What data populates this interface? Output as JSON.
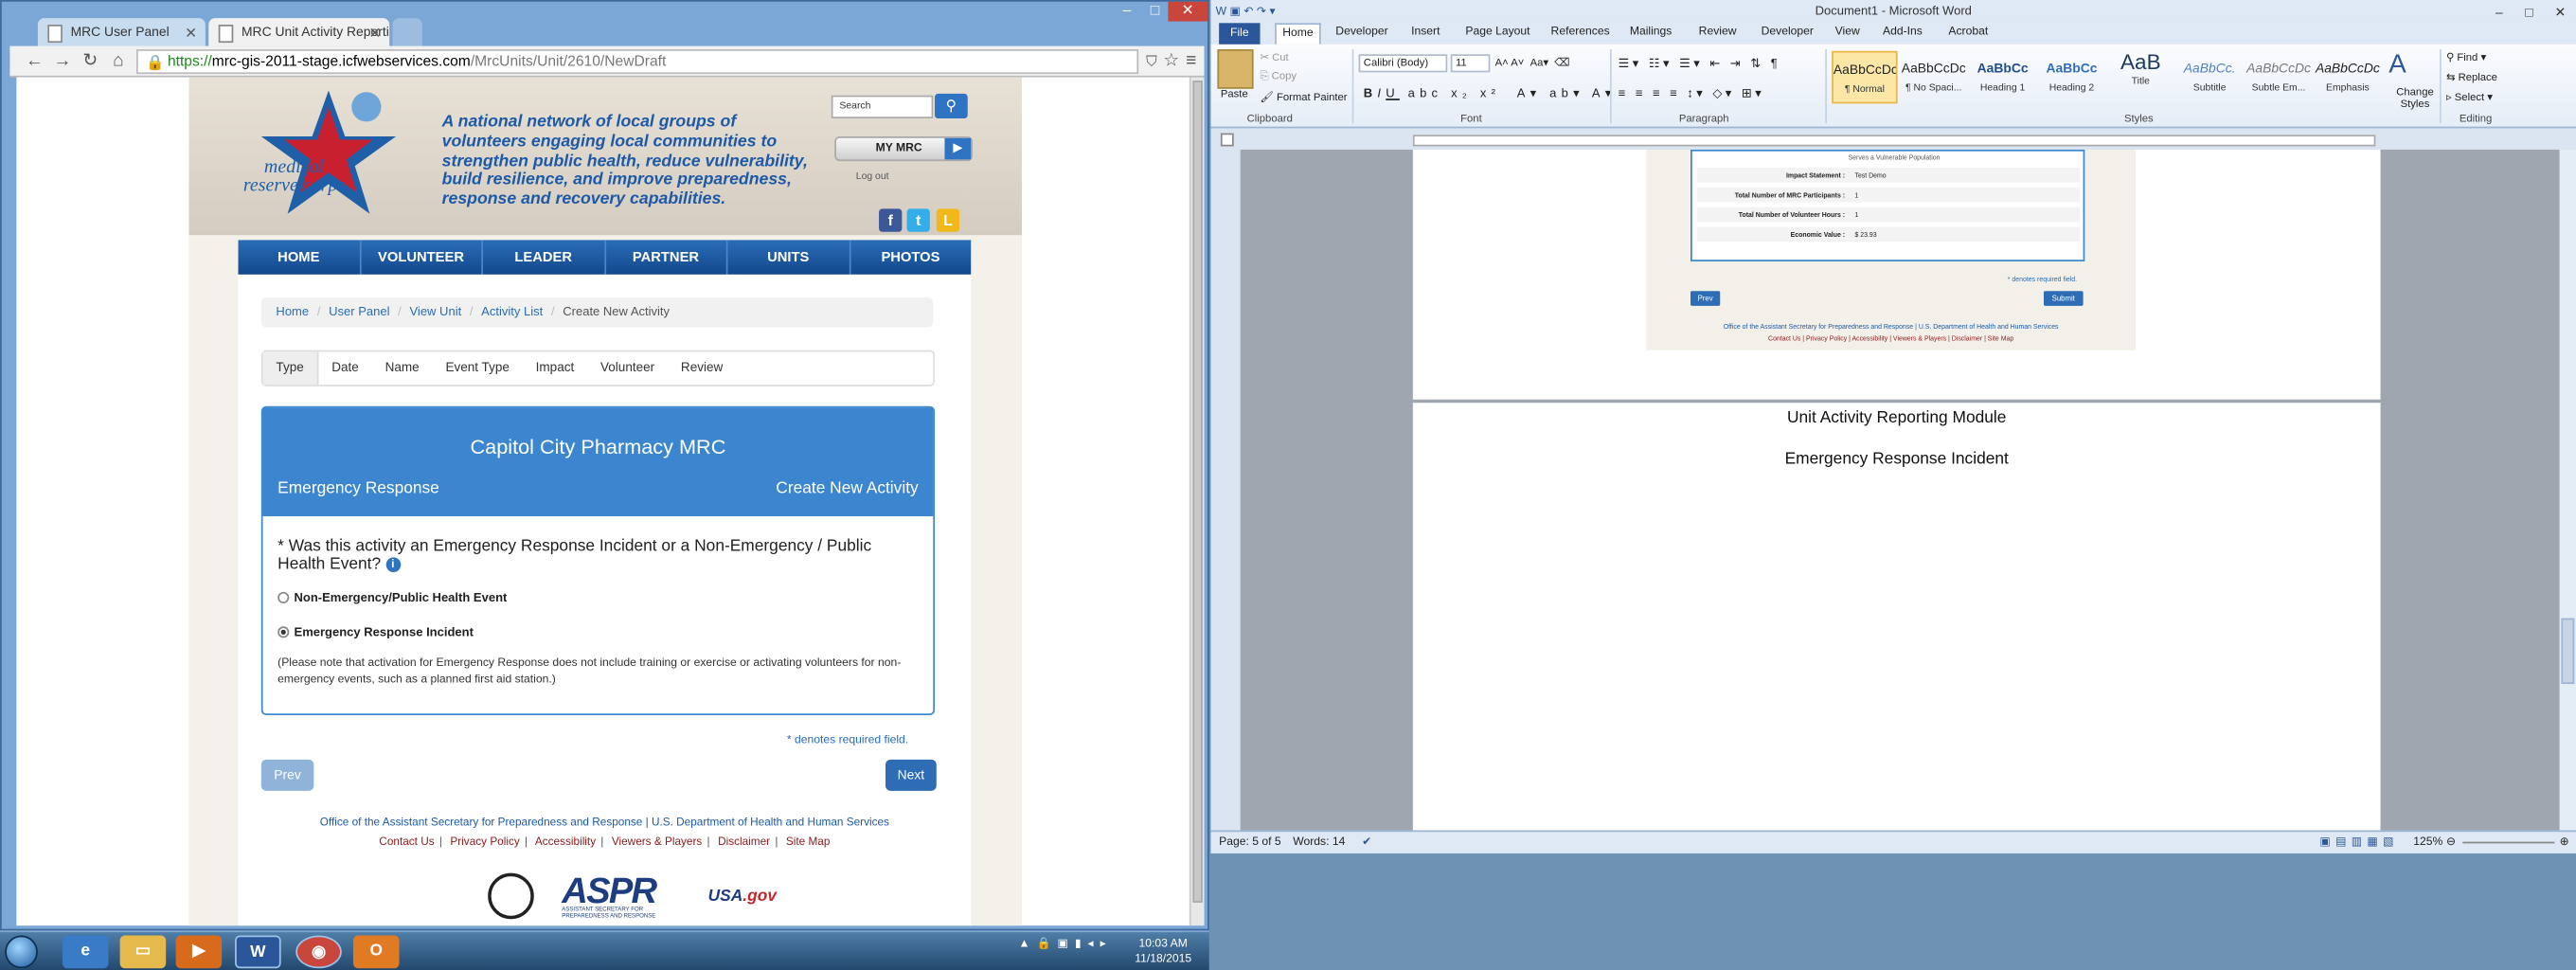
{
  "chrome": {
    "tabs": [
      "MRC User Panel",
      "MRC Unit Activity Reportin"
    ],
    "url_scheme": "https://",
    "url_host": "mrc-gis-2011-stage.icfwebservices.com",
    "url_path": "/MrcUnits/Unit/2610/NewDraft"
  },
  "site": {
    "logo_text": "medical reserve corps",
    "tagline": "A national network of local groups of volunteers engaging local communities to strengthen public health, reduce vulnerability, build resilience, and improve preparedness, response and recovery capabilities.",
    "search_placeholder": "Search",
    "my_mrc": "MY MRC",
    "logout": "Log out",
    "social": [
      "f",
      "t",
      "L"
    ],
    "nav": [
      "HOME",
      "VOLUNTEER",
      "LEADER",
      "PARTNER",
      "UNITS",
      "PHOTOS"
    ],
    "breadcrumb": [
      "Home",
      "User Panel",
      "View Unit",
      "Activity List",
      "Create New Activity"
    ],
    "wizard_tabs": [
      "Type",
      "Date",
      "Name",
      "Event Type",
      "Impact",
      "Volunteer",
      "Review"
    ],
    "panel": {
      "title": "Capitol City Pharmacy MRC",
      "activity_type": "Emergency Response",
      "action": "Create New Activity",
      "question": "* Was this activity an Emergency Response Incident or a Non-Emergency / Public Health Event?",
      "options": [
        "Non-Emergency/Public Health Event",
        "Emergency Response Incident"
      ],
      "selected_option": "Emergency Response Incident",
      "note": "(Please note that activation for Emergency Response does not include training or exercise or activating volunteers for non-emergency events, such as a planned first aid station.)"
    },
    "required_note": "* denotes required field.",
    "prev": "Prev",
    "next": "Next",
    "footer_line": "Office of the Assistant Secretary for Preparedness and Response | U.S. Department of Health and Human Services",
    "footer_links": [
      "Contact Us",
      "Privacy Policy",
      "Accessibility",
      "Viewers & Players",
      "Disclaimer",
      "Site Map"
    ],
    "aspr": "ASPR",
    "aspr_sub": "ASSISTANT SECRETARY FOR PREPAREDNESS AND RESPONSE",
    "usagov": "USA",
    "usagov_suffix": ".gov"
  },
  "taskbar": {
    "time": "10:03 AM",
    "date": "11/18/2015"
  },
  "word": {
    "title": "Document1 - Microsoft Word",
    "menu": [
      "File",
      "Home",
      "Developer",
      "Insert",
      "Page Layout",
      "References",
      "Mailings",
      "Review",
      "Developer",
      "View",
      "Add-Ins",
      "Acrobat"
    ],
    "clipboard": {
      "paste": "Paste",
      "cut": "Cut",
      "copy": "Copy",
      "format_painter": "Format Painter",
      "label": "Clipboard"
    },
    "font": {
      "name": "Calibri (Body)",
      "size": "11",
      "label": "Font"
    },
    "paragraph_label": "Paragraph",
    "styles": [
      {
        "preview": "AaBbCcDc",
        "name": "¶ Normal"
      },
      {
        "preview": "AaBbCcDc",
        "name": "¶ No Spaci..."
      },
      {
        "preview": "AaBbCc",
        "name": "Heading 1"
      },
      {
        "preview": "AaBbCc",
        "name": "Heading 2"
      },
      {
        "preview": "AaB",
        "name": "Title"
      },
      {
        "preview": "AaBbCc.",
        "name": "Subtitle"
      },
      {
        "preview": "AaBbCcDc",
        "name": "Subtle Em..."
      },
      {
        "preview": "AaBbCcDc",
        "name": "Emphasis"
      }
    ],
    "styles_label": "Styles",
    "change_styles": "Change Styles",
    "editing": {
      "find": "Find",
      "replace": "Replace",
      "select": "Select",
      "label": "Editing"
    },
    "embedded": {
      "fragment": "Serves a Vulnerable Population",
      "rows": [
        {
          "k": "Impact Statement :",
          "v": "Test Demo"
        },
        {
          "k": "Total Number of MRC Participants :",
          "v": "1"
        },
        {
          "k": "Total Number of Volunteer Hours :",
          "v": "1"
        },
        {
          "k": "Economic Value :",
          "v": "$ 23.93"
        }
      ],
      "required": "* denotes required field.",
      "prev": "Prev",
      "submit": "Submit",
      "footer1": "Office of the Assistant Secretary for Preparedness and Response | U.S. Department of Health and Human Services",
      "footer2": "Contact Us | Privacy Policy | Accessibility | Viewers & Players | Disclaimer | Site Map"
    },
    "doc_lines": [
      "Unit Activity Reporting Module",
      "Emergency Response Incident"
    ],
    "status": {
      "page": "Page: 5 of 5",
      "words": "Words: 14",
      "zoom": "125%"
    }
  }
}
